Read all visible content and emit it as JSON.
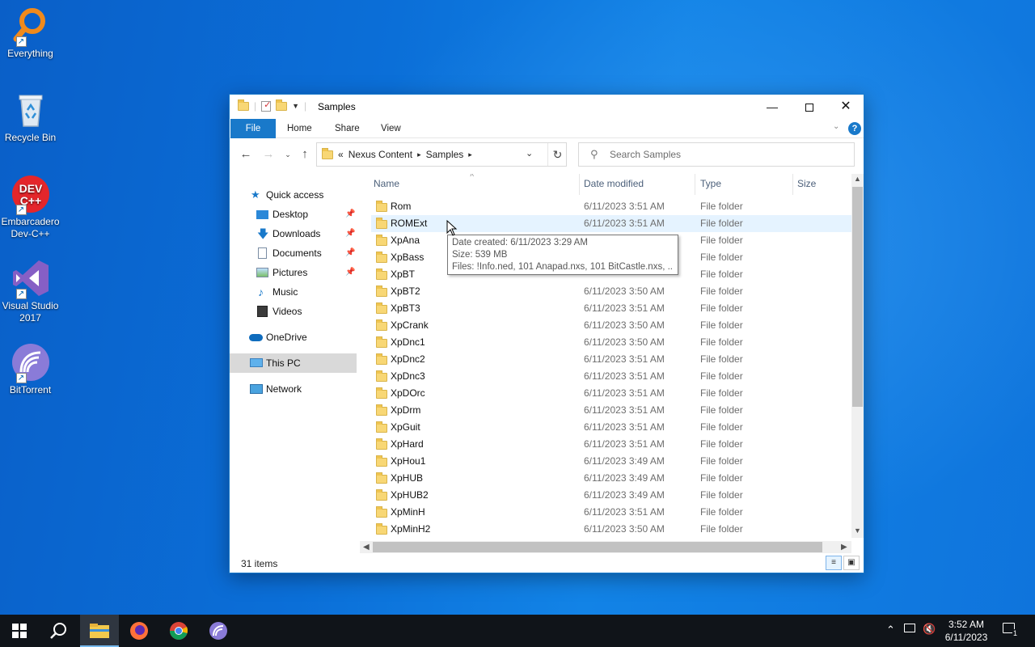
{
  "desktop": {
    "icons": [
      {
        "label": "Everything"
      },
      {
        "label": "Recycle Bin"
      },
      {
        "label": "Embarcadero Dev-C++"
      },
      {
        "label": "Visual Studio 2017"
      },
      {
        "label": "BitTorrent"
      }
    ],
    "devcpp_logo_top": "DEV",
    "devcpp_logo_bottom": "C++"
  },
  "window": {
    "title": "Samples",
    "ribbon_tabs": [
      "File",
      "Home",
      "Share",
      "View"
    ],
    "help_label": "?",
    "address": {
      "overflow": "«",
      "crumbs": [
        "Nexus Content",
        "Samples"
      ]
    },
    "search_placeholder": "Search Samples",
    "nav_pane": [
      {
        "label": "Quick access",
        "icon": "star-icon"
      },
      {
        "label": "Desktop",
        "icon": "desktop-icon",
        "pinned": true
      },
      {
        "label": "Downloads",
        "icon": "download-icon",
        "pinned": true
      },
      {
        "label": "Documents",
        "icon": "documents-icon",
        "pinned": true
      },
      {
        "label": "Pictures",
        "icon": "pictures-icon",
        "pinned": true
      },
      {
        "label": "Music",
        "icon": "music-icon"
      },
      {
        "label": "Videos",
        "icon": "videos-icon"
      },
      {
        "label": "OneDrive",
        "icon": "cloud-icon"
      },
      {
        "label": "This PC",
        "icon": "computer-icon",
        "selected": true
      },
      {
        "label": "Network",
        "icon": "network-icon"
      }
    ],
    "columns": [
      "Name",
      "Date modified",
      "Type",
      "Size"
    ],
    "files": [
      {
        "name": "Rom",
        "date": "6/11/2023 3:51 AM",
        "type": "File folder"
      },
      {
        "name": "ROMExt",
        "date": "6/11/2023 3:51 AM",
        "type": "File folder"
      },
      {
        "name": "XpAna",
        "date": "",
        "type": "File folder"
      },
      {
        "name": "XpBass",
        "date": "",
        "type": "File folder"
      },
      {
        "name": "XpBT",
        "date": "",
        "type": "File folder"
      },
      {
        "name": "XpBT2",
        "date": "6/11/2023 3:50 AM",
        "type": "File folder"
      },
      {
        "name": "XpBT3",
        "date": "6/11/2023 3:51 AM",
        "type": "File folder"
      },
      {
        "name": "XpCrank",
        "date": "6/11/2023 3:50 AM",
        "type": "File folder"
      },
      {
        "name": "XpDnc1",
        "date": "6/11/2023 3:50 AM",
        "type": "File folder"
      },
      {
        "name": "XpDnc2",
        "date": "6/11/2023 3:51 AM",
        "type": "File folder"
      },
      {
        "name": "XpDnc3",
        "date": "6/11/2023 3:51 AM",
        "type": "File folder"
      },
      {
        "name": "XpDOrc",
        "date": "6/11/2023 3:51 AM",
        "type": "File folder"
      },
      {
        "name": "XpDrm",
        "date": "6/11/2023 3:51 AM",
        "type": "File folder"
      },
      {
        "name": "XpGuit",
        "date": "6/11/2023 3:51 AM",
        "type": "File folder"
      },
      {
        "name": "XpHard",
        "date": "6/11/2023 3:51 AM",
        "type": "File folder"
      },
      {
        "name": "XpHou1",
        "date": "6/11/2023 3:49 AM",
        "type": "File folder"
      },
      {
        "name": "XpHUB",
        "date": "6/11/2023 3:49 AM",
        "type": "File folder"
      },
      {
        "name": "XpHUB2",
        "date": "6/11/2023 3:49 AM",
        "type": "File folder"
      },
      {
        "name": "XpMinH",
        "date": "6/11/2023 3:51 AM",
        "type": "File folder"
      },
      {
        "name": "XpMinH2",
        "date": "6/11/2023 3:50 AM",
        "type": "File folder"
      }
    ],
    "hovered_row": 1,
    "tooltip": {
      "line1": "Date created: 6/11/2023 3:29 AM",
      "line2": "Size: 539 MB",
      "line3": "Files: !Info.ned, 101 Anapad.nxs, 101 BitCastle.nxs, ..."
    },
    "status": "31 items"
  },
  "taskbar": {
    "time": "3:52 AM",
    "date": "6/11/2023",
    "notification_count": "1",
    "accent": "#76b9ed"
  }
}
